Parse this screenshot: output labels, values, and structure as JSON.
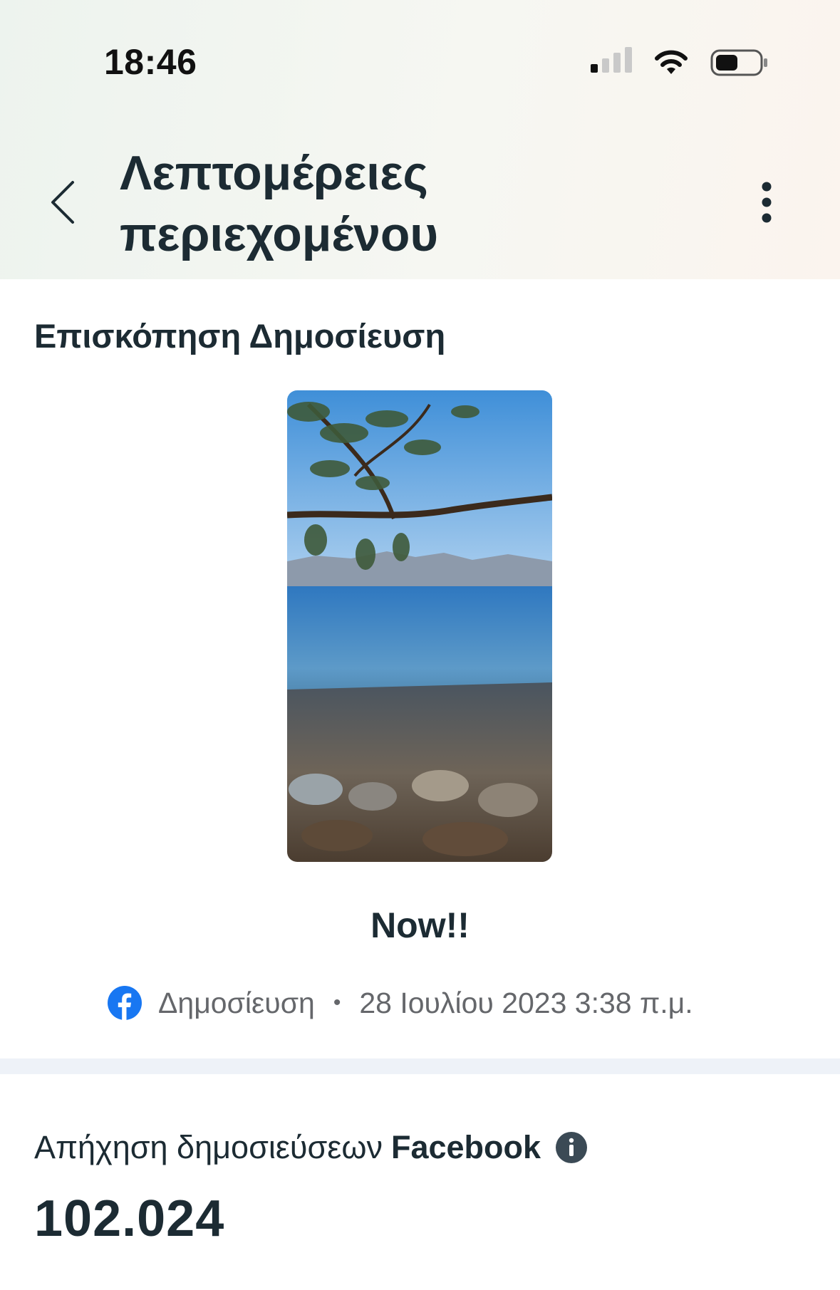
{
  "status_bar": {
    "time": "18:46",
    "icons": [
      "cellular-signal-icon",
      "wifi-icon",
      "battery-icon"
    ]
  },
  "header": {
    "title": "Λεπτομέρειες περιεχομένου",
    "back_icon": "chevron-left-icon",
    "more_icon": "more-vertical-icon"
  },
  "preview": {
    "section_title": "Επισκόπηση Δημοσίευση",
    "caption": "Now!!",
    "platform_icon": "facebook-icon",
    "post_type": "Δημοσίευση",
    "separator": "•",
    "date": "28 Ιουλίου 2023 3:38 π.μ."
  },
  "metric": {
    "label": "Απήχηση δημοσιεύσεων",
    "brand": "Facebook",
    "info_icon": "info-icon",
    "value": "102.024"
  },
  "colors": {
    "text_primary": "#1c2b33",
    "text_secondary": "#65676b",
    "facebook_blue": "#1877f2",
    "divider": "#eef2f8"
  }
}
